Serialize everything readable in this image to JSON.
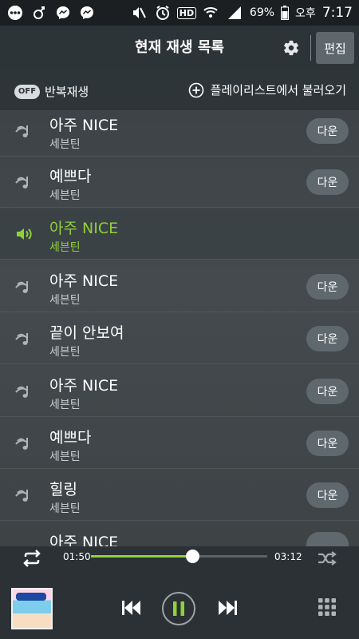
{
  "status_bar": {
    "icons": [
      "more-icon",
      "mom-app-icon",
      "messenger-icon",
      "messenger-icon",
      "mute-icon",
      "alarm-icon",
      "hd-icon",
      "wifi-icon",
      "signal-icon"
    ],
    "hd_label": "HD",
    "battery": "69%",
    "ampm": "오후",
    "time": "7:17"
  },
  "header": {
    "title": "현재 재생 목록",
    "settings_icon": "gear-icon",
    "edit_label": "편집"
  },
  "options": {
    "repeat_toggle": "OFF",
    "repeat_label": "반복재생",
    "load_playlist_label": "플레이리스트에서 불러오기"
  },
  "tracks": [
    {
      "title": "아주 NICE",
      "artist": "세븐틴",
      "download": "다운",
      "active": false
    },
    {
      "title": "예쁘다",
      "artist": "세븐틴",
      "download": "다운",
      "active": false
    },
    {
      "title": "아주 NICE",
      "artist": "세븐틴",
      "download": "",
      "active": true
    },
    {
      "title": "아주 NICE",
      "artist": "세븐틴",
      "download": "다운",
      "active": false
    },
    {
      "title": "끝이 안보여",
      "artist": "세븐틴",
      "download": "다운",
      "active": false
    },
    {
      "title": "아주 NICE",
      "artist": "세븐틴",
      "download": "다운",
      "active": false
    },
    {
      "title": "예쁘다",
      "artist": "세븐틴",
      "download": "다운",
      "active": false
    },
    {
      "title": "힐링",
      "artist": "세븐틴",
      "download": "다운",
      "active": false
    },
    {
      "title": "아주 NICE",
      "artist": "",
      "download": "",
      "active": false
    }
  ],
  "player": {
    "current_time": "01:50",
    "total_time": "03:12",
    "progress": 0.574,
    "state": "playing"
  },
  "colors": {
    "accent": "#8fd13a",
    "background": "#3a3f42",
    "header": "#2d3437",
    "button": "#5f686d"
  }
}
